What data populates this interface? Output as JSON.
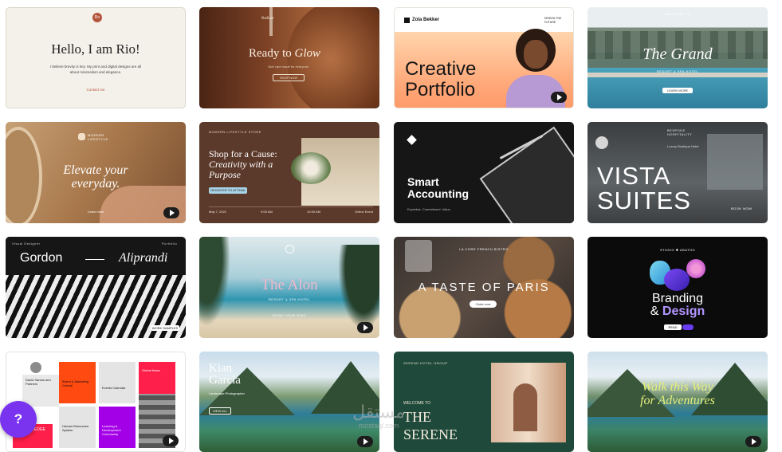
{
  "cards": {
    "rio": {
      "monogram": "Ro",
      "title": "Hello, I am Rio!",
      "body": "I believe brevity is key. My print and digital designs are all about minimalism and elegance.",
      "cta": "Contact me"
    },
    "glow": {
      "brand": "Radiant",
      "title_a": "Ready to",
      "title_b": "Glow",
      "subtitle": "Skin care made for everyone",
      "cta": "SHOP NOW"
    },
    "zola": {
      "brand": "Zola Bekker",
      "tag": "DESIGN THE FUTURE",
      "title": "Creative Portfolio"
    },
    "grand": {
      "kicker": "WELCOME TO",
      "title": "The Grand",
      "subtitle": "RESORT & SPA HOTEL",
      "cta": "LEARN MORE"
    },
    "lifestyle": {
      "brand": "MODERN LIFESTYLE",
      "title": "Elevate your everyday.",
      "cta": "Learn more"
    },
    "cause": {
      "brand": "MODERN LIFESTYLE STORE",
      "title_a": "Shop for a Cause:",
      "title_b": "Creativity with a Purpose",
      "cta": "REGISTER TO ATTEND",
      "info": [
        "May 7, 2021",
        "9:00 AM",
        "10:00 AM",
        "Online Event"
      ]
    },
    "accounting": {
      "title": "Smart Accounting",
      "tagline": "Expertise. Commitment. Value."
    },
    "vista": {
      "brand": "BESPOKE HOSPITALITY",
      "title": "VISTA SUITES",
      "subtitle": "Luxury Boutique Hotel",
      "cta": "BOOK NOW"
    },
    "gordon": {
      "top_left": "Visual Designer",
      "top_right": "Portfolio",
      "first": "Gordon",
      "last": "Aliprandi",
      "cta": "WORK SAMPLES"
    },
    "alon": {
      "title": "The Alon",
      "subtitle": "RESORT & SPA HOTEL",
      "cta": "BOOK YOUR STAY"
    },
    "paris": {
      "kicker": "LA CORE FRENCH BISTRO",
      "title": "A TASTE OF PARIS",
      "cta": "Order now"
    },
    "branding": {
      "studio": "STUDIO ✱ ABATHO",
      "title_a": "Branding",
      "title_b": "&",
      "title_c": "Design",
      "cta": "READ MORE"
    },
    "dashboard": {
      "tiles": [
        "David Santos and Partners",
        "Brand & Marketing Central",
        "Events Calendar",
        "Global News",
        "Human Resources System",
        "Learning & Development Community"
      ],
      "partial": "LEDGE"
    },
    "kian": {
      "title": "Kian Garcia",
      "subtitle": "Landscape Photographer",
      "cta": "VIEW ALL"
    },
    "serene": {
      "brand": "SERENE HOTEL GROUP",
      "kicker": "WELCOME TO",
      "title_a": "THE",
      "title_b": "SERENE"
    },
    "walk": {
      "title_a": "Walk this Way",
      "title_b": "for Adventures"
    }
  },
  "help": {
    "label": "?"
  },
  "watermark": {
    "arabic": "مستقل",
    "latin": "mostaql.com"
  },
  "colors": {
    "help_bg": "#7a34f0",
    "accent_purple": "#6a3cf2"
  }
}
